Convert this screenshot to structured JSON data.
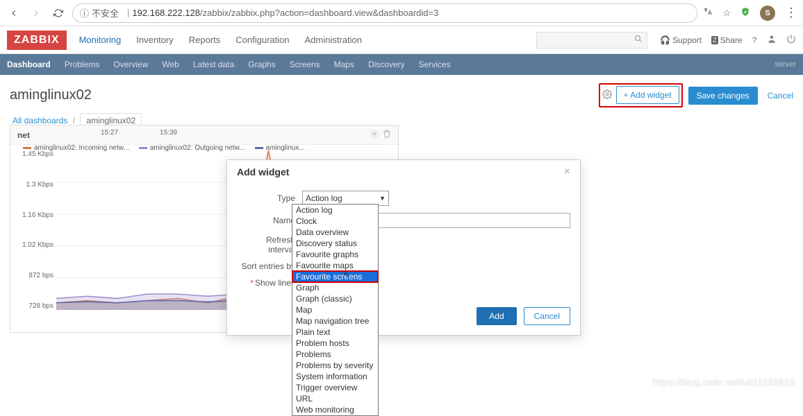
{
  "browser": {
    "insecure_label": "不安全",
    "url_host": "192.168.222.128",
    "url_path": "/zabbix/zabbix.php?action=dashboard.view&dashboardid=3",
    "avatar_letter": "S"
  },
  "logo": "ZABBIX",
  "header_nav": [
    "Monitoring",
    "Inventory",
    "Reports",
    "Configuration",
    "Administration"
  ],
  "header_nav_active": 0,
  "header_actions": {
    "support": "Support",
    "share": "Share"
  },
  "subnav": [
    "Dashboard",
    "Problems",
    "Overview",
    "Web",
    "Latest data",
    "Graphs",
    "Screens",
    "Maps",
    "Discovery",
    "Services"
  ],
  "subnav_active": 0,
  "server_label": "server",
  "page": {
    "title": "aminglinux02",
    "add_widget": "Add widget",
    "save": "Save changes",
    "cancel": "Cancel"
  },
  "breadcrumb": {
    "root": "All dashboards",
    "current": "aminglinux02"
  },
  "widget": {
    "title": "net"
  },
  "modal": {
    "title": "Add widget",
    "labels": {
      "type": "Type",
      "name": "Name",
      "refresh": "Refresh interval",
      "sort": "Sort entries by",
      "show_lines": "Show lines"
    },
    "type_value": "Action log",
    "add": "Add",
    "cancel": "Cancel"
  },
  "dropdown_options": [
    "Action log",
    "Clock",
    "Data overview",
    "Discovery status",
    "Favourite graphs",
    "Favourite maps",
    "Favourite screens",
    "Graph",
    "Graph (classic)",
    "Map",
    "Map navigation tree",
    "Plain text",
    "Problem hosts",
    "Problems",
    "Problems by severity",
    "System information",
    "Trigger overview",
    "URL",
    "Web monitoring"
  ],
  "dropdown_selected_index": 6,
  "chart_data": {
    "type": "area",
    "ylabel": "",
    "xlabel": "",
    "y_ticks": [
      "1.45 Kbps",
      "1.3 Kbps",
      "1.16 Kbps",
      "1.02 Kbps",
      "872 bps",
      "728 bps"
    ],
    "x_ticks": [
      "15:27",
      "15:39"
    ],
    "ylim_bps": [
      728,
      1450
    ],
    "series": [
      {
        "name": "aminglinux02: Incoming netw...",
        "color": "#d97a4a",
        "values_bps": [
          760,
          770,
          760,
          770,
          780,
          760,
          790,
          1450,
          800,
          770,
          790,
          780
        ]
      },
      {
        "name": "aminglinux02: Outgoing netw...",
        "color": "#9b8acb",
        "values_bps": [
          780,
          790,
          780,
          800,
          800,
          790,
          800,
          830,
          810,
          800,
          810,
          800
        ]
      },
      {
        "name": "aminglinux...",
        "color": "#5a6aa8",
        "values_bps": [
          760,
          765,
          760,
          770,
          770,
          765,
          770,
          780,
          770,
          770,
          775,
          770
        ]
      }
    ]
  },
  "watermark": "https://blog.csdn.net/u011192615"
}
